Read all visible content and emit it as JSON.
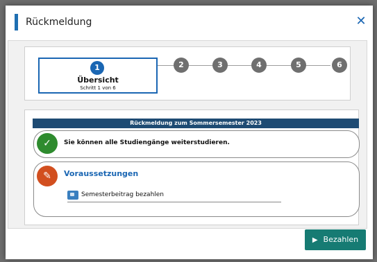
{
  "dialog": {
    "title": "Rückmeldung",
    "close_glyph": "✕"
  },
  "stepper": {
    "active_step": "1",
    "active_title": "Übersicht",
    "active_subtitle": "Schritt 1 von 6",
    "steps": [
      "2",
      "3",
      "4",
      "5",
      "6"
    ]
  },
  "content": {
    "banner": "Rückmeldung zum Sommersemester 2023",
    "status_text": "Sie können alle Studiengänge weiterstudieren.",
    "requirements_title": "Voraussetzungen",
    "requirement_item": "Semesterbeitrag bezahlen"
  },
  "actions": {
    "pay_label": "Bezahlen"
  },
  "icons": {
    "check": "✓",
    "pencil": "✎",
    "arrow": "▶"
  },
  "colors": {
    "accent": "#1a66b3",
    "banner": "#1e4b73",
    "success": "#2e8b2e",
    "warning": "#d24f1f",
    "pay_button": "#167b73"
  }
}
